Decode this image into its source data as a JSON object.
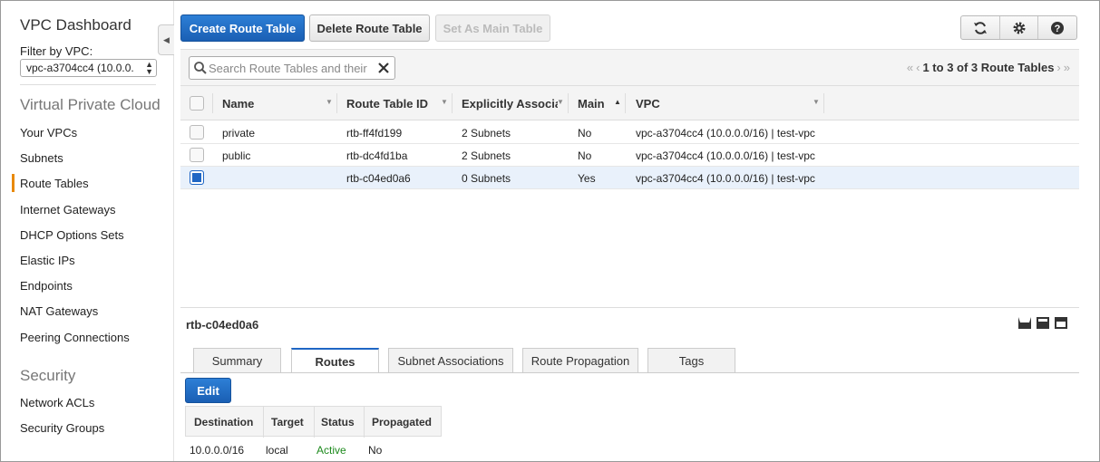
{
  "sidebar": {
    "title": "VPC Dashboard",
    "filter_label": "Filter by VPC:",
    "filter_value": "vpc-a3704cc4 (10.0.0.",
    "sections": {
      "vpc": "Virtual Private Cloud",
      "security": "Security"
    },
    "vpc_items": [
      "Your VPCs",
      "Subnets",
      "Route Tables",
      "Internet Gateways",
      "DHCP Options Sets",
      "Elastic IPs",
      "Endpoints",
      "NAT Gateways",
      "Peering Connections"
    ],
    "security_items": [
      "Network ACLs",
      "Security Groups"
    ],
    "active_item": "Route Tables"
  },
  "toolbar": {
    "create_label": "Create Route Table",
    "delete_label": "Delete Route Table",
    "set_main_label": "Set As Main Table"
  },
  "search": {
    "placeholder": "Search Route Tables and their"
  },
  "pager": {
    "text": "1 to 3 of 3 Route Tables"
  },
  "table": {
    "columns": [
      "Name",
      "Route Table ID",
      "Explicitly Associat",
      "Main",
      "VPC"
    ],
    "rows": [
      {
        "name": "private",
        "id": "rtb-ff4fd199",
        "assoc": "2 Subnets",
        "main": "No",
        "vpc": "vpc-a3704cc4 (10.0.0.0/16) | test-vpc",
        "selected": false
      },
      {
        "name": "public",
        "id": "rtb-dc4fd1ba",
        "assoc": "2 Subnets",
        "main": "No",
        "vpc": "vpc-a3704cc4 (10.0.0.0/16) | test-vpc",
        "selected": false
      },
      {
        "name": "",
        "id": "rtb-c04ed0a6",
        "assoc": "0 Subnets",
        "main": "Yes",
        "vpc": "vpc-a3704cc4 (10.0.0.0/16) | test-vpc",
        "selected": true
      }
    ]
  },
  "detail": {
    "selected_id": "rtb-c04ed0a6",
    "tabs": [
      "Summary",
      "Routes",
      "Subnet Associations",
      "Route Propagation",
      "Tags"
    ],
    "active_tab": "Routes",
    "edit_label": "Edit",
    "routes_columns": [
      "Destination",
      "Target",
      "Status",
      "Propagated"
    ],
    "routes": [
      {
        "destination": "10.0.0.0/16",
        "target": "local",
        "status": "Active",
        "propagated": "No"
      }
    ]
  },
  "colors": {
    "primary": "#1a5fb4",
    "active_status": "#1d8a1d",
    "sidebar_accent": "#e8890c",
    "selected_row": "#e9f1fb"
  },
  "icons": [
    "collapse-chevron-icon",
    "refresh-icon",
    "gear-icon",
    "help-icon",
    "search-icon",
    "clear-icon",
    "first-page-icon",
    "prev-page-icon",
    "next-page-icon",
    "last-page-icon"
  ]
}
